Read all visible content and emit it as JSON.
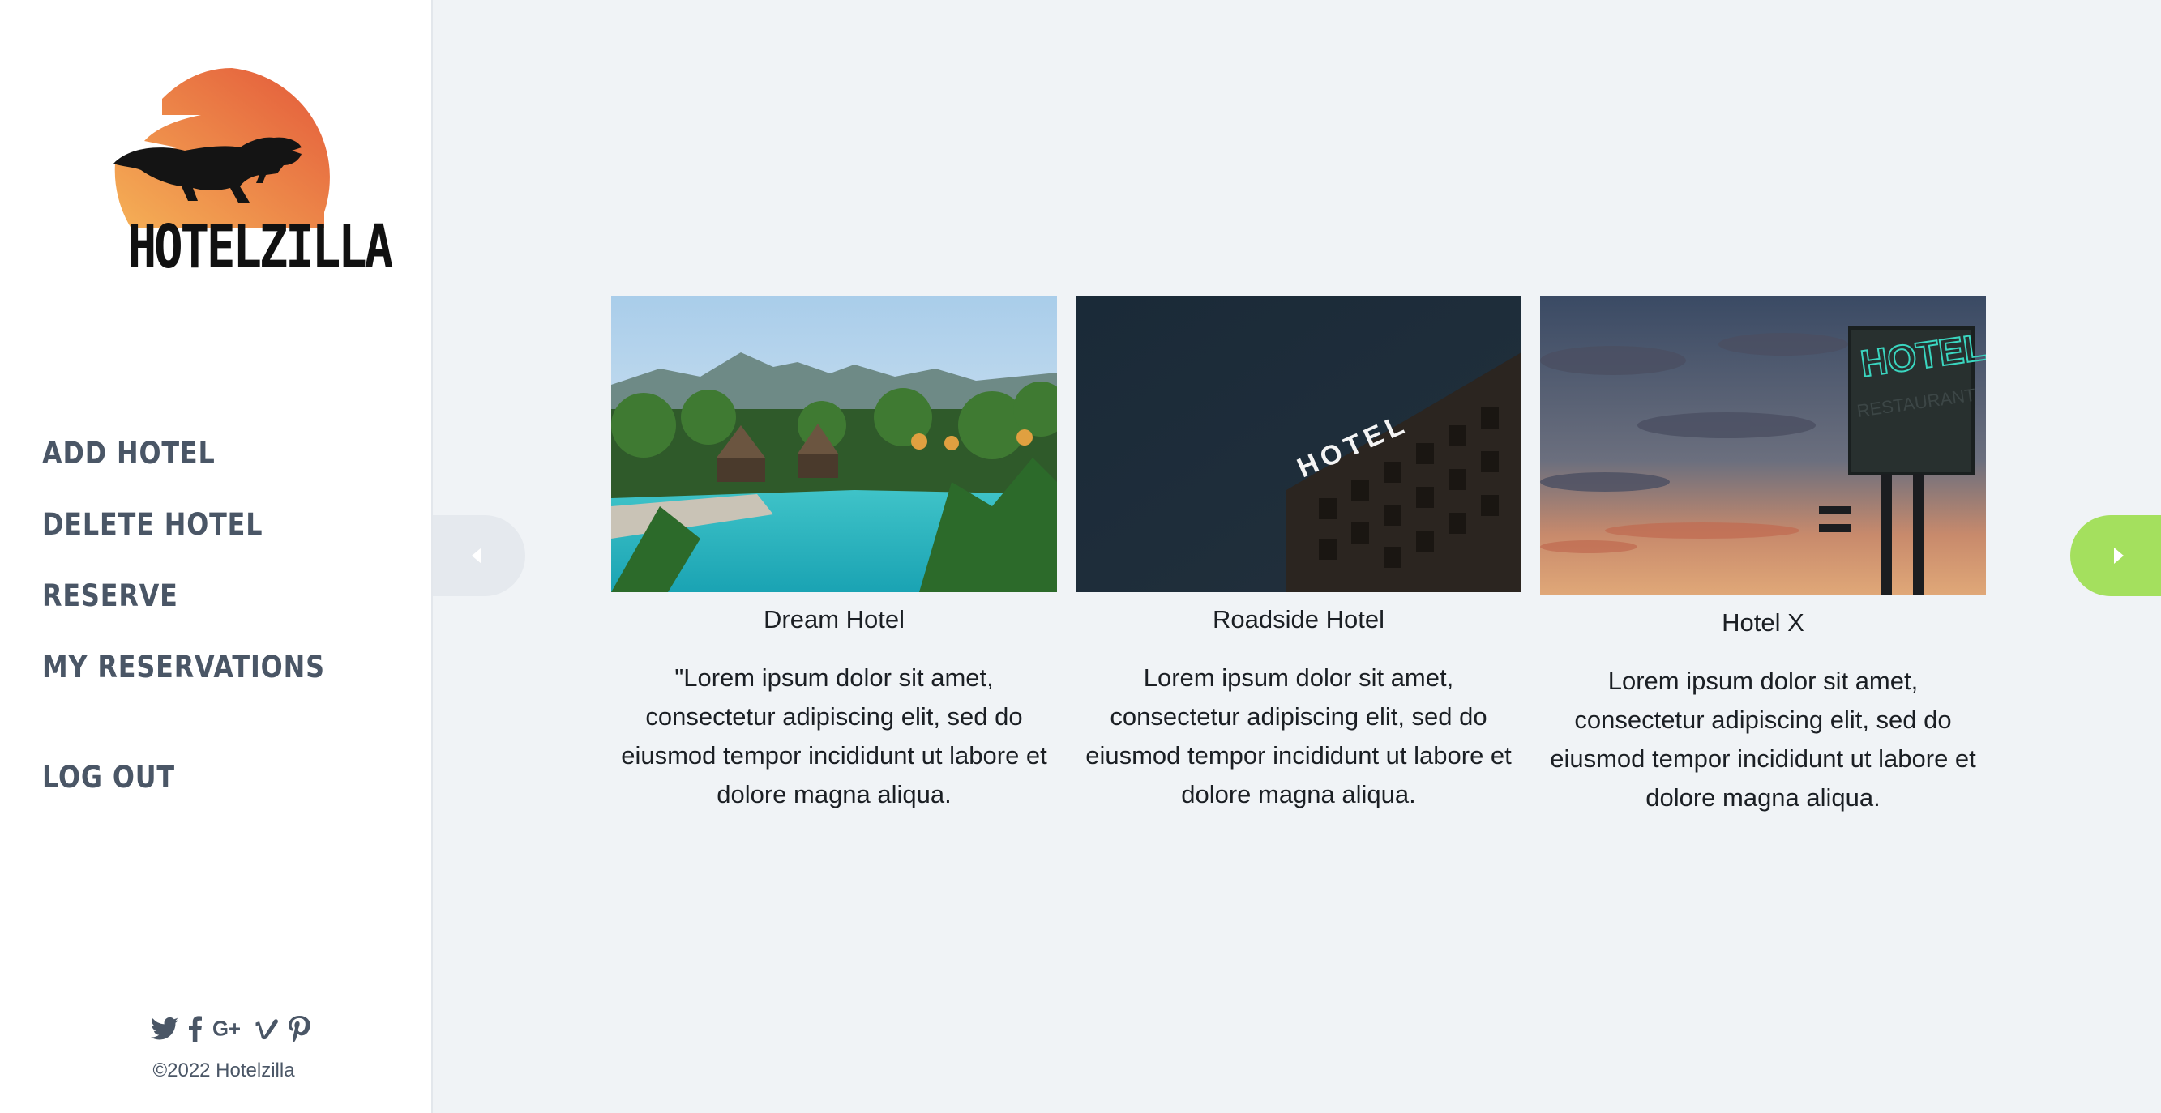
{
  "brand": {
    "name": "HOTELZILLA"
  },
  "nav": {
    "items": [
      {
        "label": "ADD HOTEL"
      },
      {
        "label": "DELETE HOTEL"
      },
      {
        "label": "RESERVE"
      },
      {
        "label": "MY RESERVATIONS"
      }
    ],
    "logout": "LOG OUT"
  },
  "footer": {
    "social_icons": [
      "twitter-icon",
      "facebook-icon",
      "google-plus-icon",
      "vimeo-icon",
      "pinterest-icon"
    ],
    "copyright": "©2022 Hotelzilla"
  },
  "hotels": [
    {
      "name": "Dream Hotel",
      "description": "\"Lorem ipsum dolor sit amet, consectetur adipiscing elit, sed do eiusmod tempor incididunt ut labore et dolore magna aliqua."
    },
    {
      "name": "Roadside Hotel",
      "description": "Lorem ipsum dolor sit amet, consectetur adipiscing elit, sed do eiusmod tempor incididunt ut labore et dolore magna aliqua."
    },
    {
      "name": "Hotel X",
      "description": "Lorem ipsum dolor sit amet, consectetur adipiscing elit, sed do eiusmod tempor incididunt ut labore et dolore magna aliqua."
    }
  ],
  "images": {
    "card1_sign": "",
    "card2_sign": "HOTEL",
    "card3_sign": "HOTEL",
    "card3_sign_sub": "RESTAURANT"
  },
  "colors": {
    "accent_next": "#a4e05e",
    "nav_text": "#4a5666",
    "logo_sun_start": "#f4a04a",
    "logo_sun_end": "#e5663a",
    "background": "#f0f3f6"
  }
}
